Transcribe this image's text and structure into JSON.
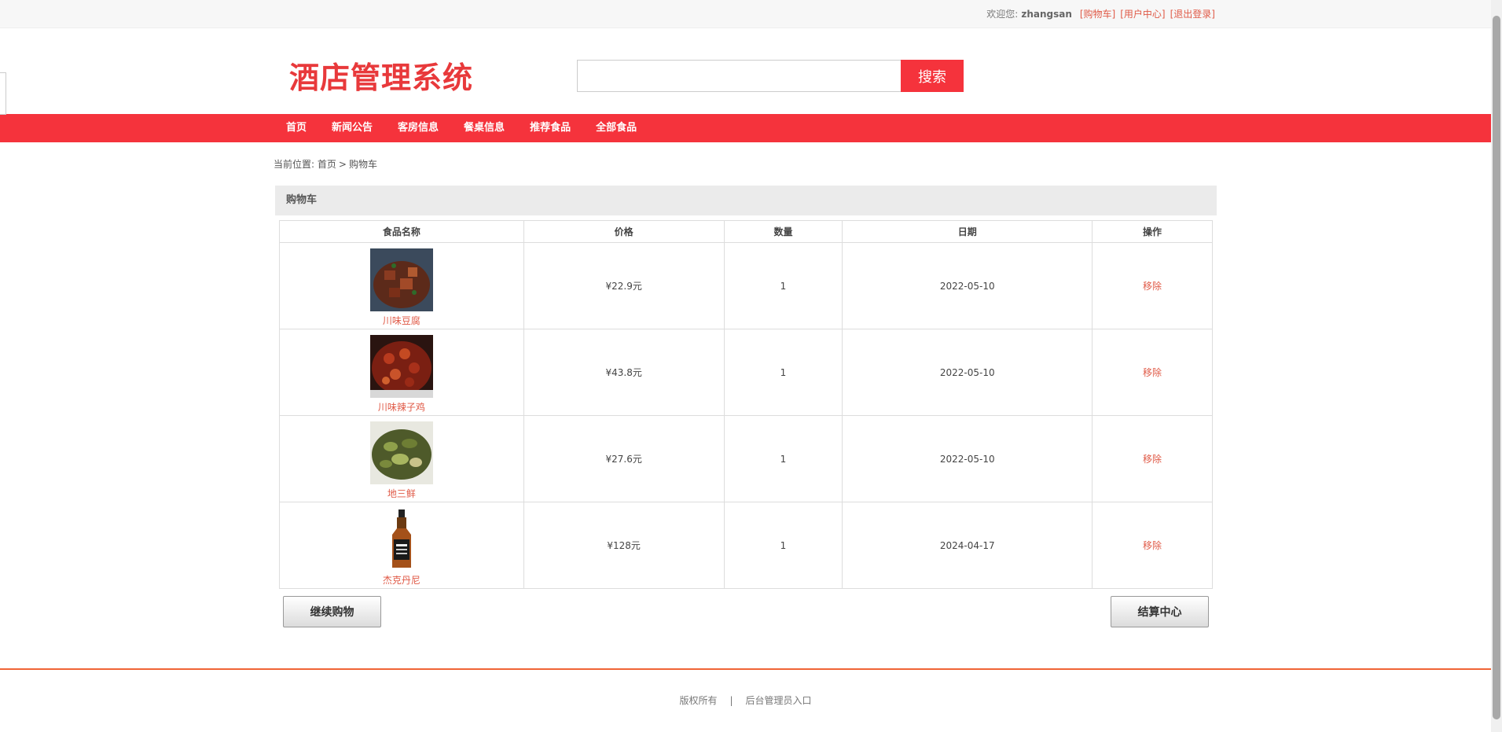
{
  "topbar": {
    "welcome": "欢迎您:",
    "username": "zhangsan",
    "links": [
      "[购物车]",
      "[用户中心]",
      "[退出登录]"
    ]
  },
  "header": {
    "logo": "酒店管理系统",
    "search_placeholder": "",
    "search_button": "搜索"
  },
  "nav": [
    "首页",
    "新闻公告",
    "客房信息",
    "餐桌信息",
    "推荐食品",
    "全部食品"
  ],
  "breadcrumb": {
    "prefix": "当前位置:",
    "home": "首页",
    "sep": ">",
    "current": "购物车"
  },
  "cart": {
    "title": "购物车",
    "columns": [
      "食品名称",
      "价格",
      "数量",
      "日期",
      "操作"
    ],
    "rows": [
      {
        "name": "川味豆腐",
        "price": "¥22.9元",
        "qty": "1",
        "date": "2022-05-10",
        "action": "移除"
      },
      {
        "name": "川味辣子鸡",
        "price": "¥43.8元",
        "qty": "1",
        "date": "2022-05-10",
        "action": "移除"
      },
      {
        "name": "地三鲜",
        "price": "¥27.6元",
        "qty": "1",
        "date": "2022-05-10",
        "action": "移除"
      },
      {
        "name": "杰克丹尼",
        "price": "¥128元",
        "qty": "1",
        "date": "2024-04-17",
        "action": "移除"
      }
    ],
    "continue_button": "继续购物",
    "checkout_button": "结算中心"
  },
  "footer": {
    "copyright": "版权所有",
    "sep": "|",
    "admin": "后台管理员入口"
  }
}
